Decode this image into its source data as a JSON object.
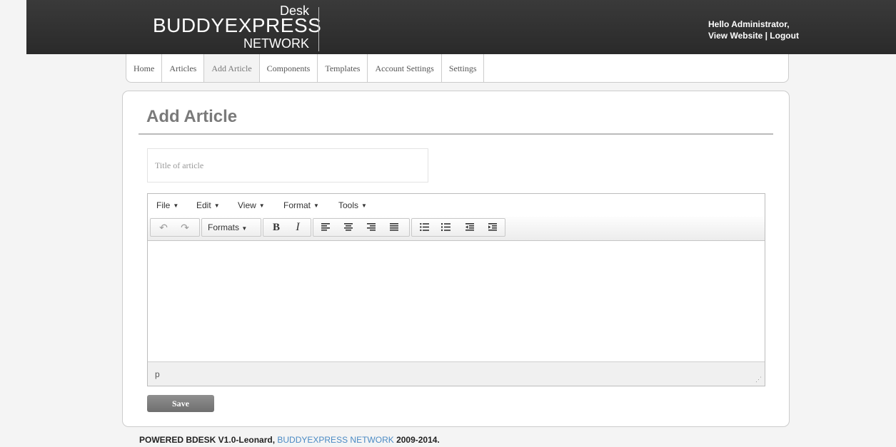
{
  "header": {
    "logo": {
      "desk": "Desk",
      "main": "BUDDYEXPRESS",
      "network": "NETWORK"
    },
    "greeting": "Hello Administrator,",
    "view_website": "View Website",
    "separator": " | ",
    "logout": "Logout"
  },
  "nav": {
    "items": [
      {
        "label": "Home"
      },
      {
        "label": "Articles"
      },
      {
        "label": "Add Article",
        "active": true
      },
      {
        "label": "Components"
      },
      {
        "label": "Templates"
      },
      {
        "label": "Account Settings"
      },
      {
        "label": "Settings"
      }
    ]
  },
  "main": {
    "title": "Add Article",
    "title_input": {
      "placeholder": "Title of article",
      "value": ""
    },
    "editor": {
      "menus": [
        "File",
        "Edit",
        "View",
        "Format",
        "Tools"
      ],
      "toolbar": {
        "formats_label": "Formats",
        "bold": "B",
        "italic": "I",
        "icons": [
          "undo-icon",
          "redo-icon",
          "align-left-icon",
          "align-center-icon",
          "align-right-icon",
          "align-justify-icon",
          "bullet-list-icon",
          "numbered-list-icon",
          "outdent-icon",
          "indent-icon"
        ]
      },
      "status_path": "p"
    },
    "save_label": "Save"
  },
  "footer": {
    "text": "POWERED BDESK V1.0-Leonard, ",
    "link": "BUDDYEXPRESS NETWORK",
    "years": " 2009-2014."
  },
  "colors": {
    "header_bg": "#2f2f2f",
    "link": "#4a8ac4",
    "save_bg": "#7f7f7f"
  }
}
